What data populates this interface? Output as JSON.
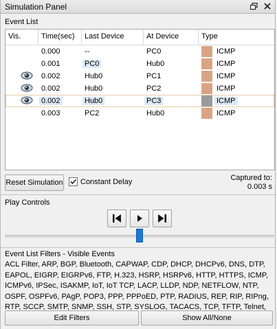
{
  "panel": {
    "title": "Simulation Panel"
  },
  "event_list": {
    "label": "Event List",
    "columns": [
      "Vis.",
      "Time(sec)",
      "Last Device",
      "At Device",
      "Type"
    ],
    "rows": [
      {
        "time": "0.000",
        "last": "--",
        "at": "PC0",
        "type": "ICMP",
        "color": "#d9a484",
        "eye": false,
        "selected": false,
        "hl_last": false,
        "hl_at": false
      },
      {
        "time": "0.001",
        "last": "PC0",
        "at": "Hub0",
        "type": "ICMP",
        "color": "#d9a484",
        "eye": false,
        "selected": false,
        "hl_last": true,
        "hl_at": false
      },
      {
        "time": "0.002",
        "last": "Hub0",
        "at": "PC1",
        "type": "ICMP",
        "color": "#d9a484",
        "eye": true,
        "selected": false,
        "hl_last": false,
        "hl_at": false
      },
      {
        "time": "0.002",
        "last": "Hub0",
        "at": "PC2",
        "type": "ICMP",
        "color": "#d9a484",
        "eye": true,
        "selected": false,
        "hl_last": false,
        "hl_at": false
      },
      {
        "time": "0.002",
        "last": "Hub0",
        "at": "PC3",
        "type": "ICMP",
        "color": "#9a9a9a",
        "eye": true,
        "selected": true,
        "hl_last": true,
        "hl_at": true
      },
      {
        "time": "0.003",
        "last": "PC2",
        "at": "Hub0",
        "type": "ICMP",
        "color": "#d9a484",
        "eye": false,
        "selected": false,
        "hl_last": false,
        "hl_at": false
      }
    ]
  },
  "controls": {
    "reset_label": "Reset Simulation",
    "constant_delay_label": "Constant Delay",
    "constant_delay_checked": true,
    "captured_label": "Captured to:",
    "captured_value": "0.003 s"
  },
  "play": {
    "label": "Play Controls",
    "slider_position": 0.5
  },
  "filters": {
    "label": "Event List Filters - Visible Events",
    "events_text": "ACL Filter, ARP, BGP, Bluetooth, CAPWAP, CDP, DHCP, DHCPv6, DNS, DTP, EAPOL, EIGRP, EIGRPv6, FTP, H.323, HSRP, HSRPv6, HTTP, HTTPS, ICMP, ICMPv6, IPSec, ISAKMP, IoT, IoT TCP, LACP, LLDP, NDP, NETFLOW, NTP, OSPF, OSPFv6, PAgP, POP3, PPP, PPPoED, PTP, RADIUS, REP, RIP, RIPng, RTP, SCCP, SMTP, SNMP, SSH, STP, SYSLOG, TACACS, TCP, TFTP, Telnet, UDP, USB, VTP",
    "edit_label": "Edit Filters",
    "show_all_label": "Show All/None"
  },
  "colors": {
    "accent": "#1b79d6",
    "icmp": "#d9a484",
    "icmp_selected": "#9a9a9a",
    "highlight": "#dce9f7"
  }
}
